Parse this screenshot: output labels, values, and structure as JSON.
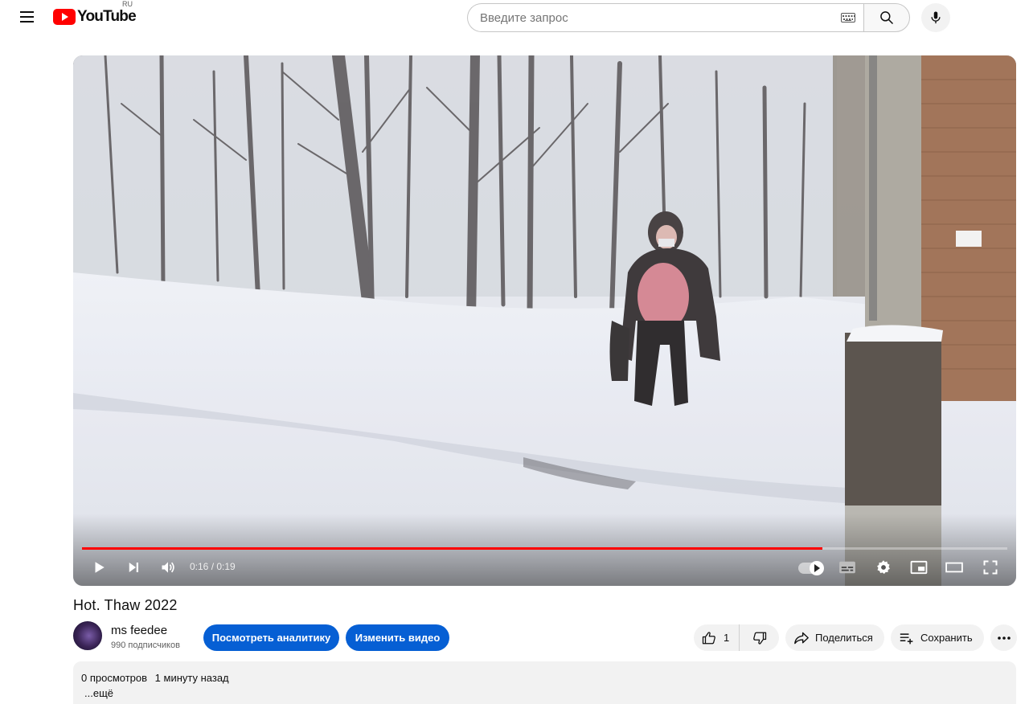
{
  "masthead": {
    "logo_text": "YouTube",
    "country_code": "RU",
    "search_placeholder": "Введите запрос"
  },
  "player": {
    "time_display": "0:16 / 0:19",
    "progress_fraction": 0.8,
    "progress_color": "#ff0000",
    "autoplay_on": true
  },
  "video": {
    "title": "Hot. Thaw 2022"
  },
  "channel": {
    "name": "ms feedee",
    "subscribers": "990 подписчиков"
  },
  "actions": {
    "analytics_label": "Посмотреть аналитику",
    "edit_label": "Изменить видео",
    "like_count": "1",
    "share_label": "Поделиться",
    "save_label": "Сохранить",
    "accent_color": "#065fd4"
  },
  "description": {
    "views": "0 просмотров",
    "uploaded": "1 минуту назад",
    "more_label": "...ещё"
  }
}
